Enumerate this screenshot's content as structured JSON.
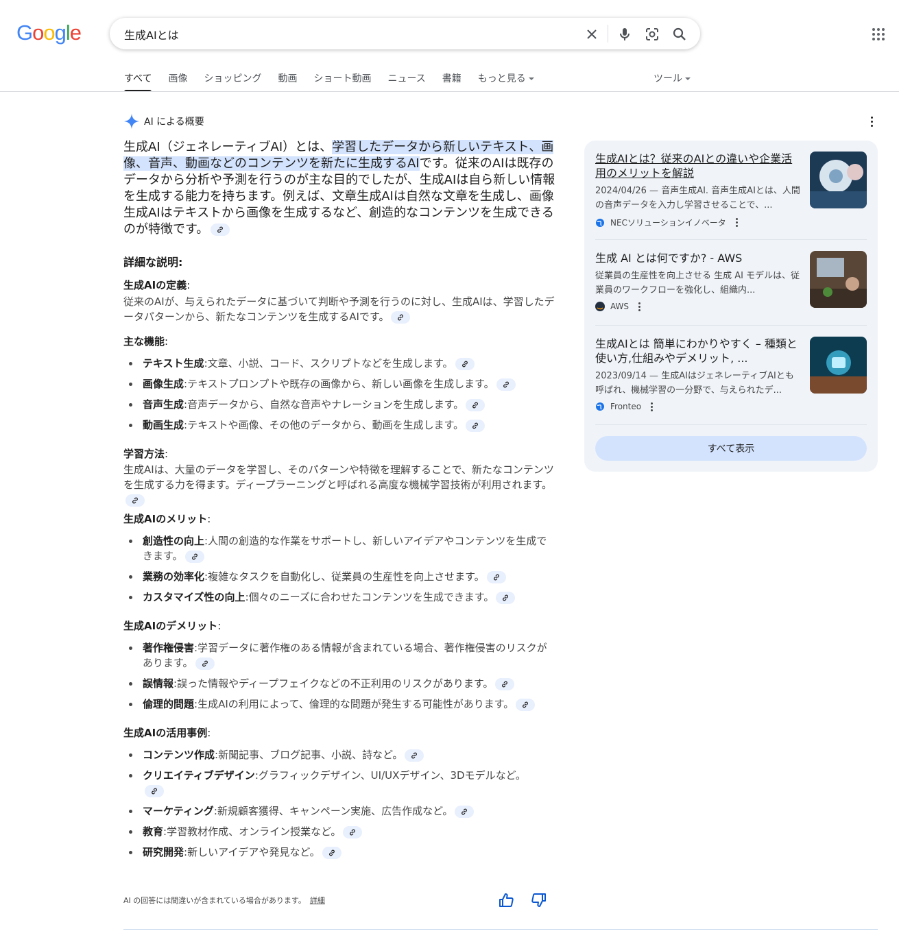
{
  "logo": {
    "letters": [
      "G",
      "o",
      "o",
      "g",
      "l",
      "e"
    ]
  },
  "search": {
    "query": "生成AIとは"
  },
  "tabs": [
    "すべて",
    "画像",
    "ショッピング",
    "動画",
    "ショート動画",
    "ニュース",
    "書籍",
    "もっと見る"
  ],
  "tools_label": "ツール",
  "ai": {
    "heading": "AI による概要",
    "intro_a": "生成AI（ジェネレーティブAI）とは、",
    "intro_highlight": "学習したデータから新しいテキスト、画像、音声、動画などのコンテンツを新たに生成するAI",
    "intro_b": "です。従来のAIは既存のデータから分析や予測を行うのが主な目的でしたが、生成AIは自ら新しい情報を生成する能力を持ちます。例えば、文章生成AIは自然な文章を生成し、画像生成AIはテキストから画像を生成するなど、創造的なコンテンツを生成できるのが特徴です。",
    "details_heading": "詳細な説明:",
    "def_title": "生成AIの定義",
    "def_text": "従来のAIが、与えられたデータに基づいて判断や予測を行うのに対し、生成AIは、学習したデータパターンから、新たなコンテンツを生成するAIです。",
    "features_title": "主な機能",
    "features": [
      {
        "term": "テキスト生成",
        "desc": ":文章、小説、コード、スクリプトなどを生成します。"
      },
      {
        "term": "画像生成",
        "desc": ":テキストプロンプトや既存の画像から、新しい画像を生成します。"
      },
      {
        "term": "音声生成",
        "desc": ":音声データから、自然な音声やナレーションを生成します。"
      },
      {
        "term": "動画生成",
        "desc": ":テキストや画像、その他のデータから、動画を生成します。"
      }
    ],
    "learning_title": "学習方法",
    "learning_text": "生成AIは、大量のデータを学習し、そのパターンや特徴を理解することで、新たなコンテンツを生成する力を得ます。ディープラーニングと呼ばれる高度な機械学習技術が利用されます。",
    "merits_title": "生成AIのメリット",
    "merits": [
      {
        "term": "創造性の向上",
        "desc": ":人間の創造的な作業をサポートし、新しいアイデアやコンテンツを生成できます。"
      },
      {
        "term": "業務の効率化",
        "desc": ":複雑なタスクを自動化し、従業員の生産性を向上させます。"
      },
      {
        "term": "カスタマイズ性の向上",
        "desc": ":個々のニーズに合わせたコンテンツを生成できます。"
      }
    ],
    "demerits_title": "生成AIのデメリット",
    "demerits": [
      {
        "term": "著作権侵害",
        "desc": ":学習データに著作権のある情報が含まれている場合、著作権侵害のリスクがあります。"
      },
      {
        "term": "誤情報",
        "desc": ":誤った情報やディープフェイクなどの不正利用のリスクがあります。"
      },
      {
        "term": "倫理的問題",
        "desc": ":生成AIの利用によって、倫理的な問題が発生する可能性があります。"
      }
    ],
    "cases_title": "生成AIの活用事例",
    "cases": [
      {
        "term": "コンテンツ作成",
        "desc": ":新聞記事、ブログ記事、小説、詩など。"
      },
      {
        "term": "クリエイティブデザイン",
        "desc": ":グラフィックデザイン、UI/UXデザイン、3Dモデルなど。"
      },
      {
        "term": "マーケティング",
        "desc": ":新規顧客獲得、キャンペーン実施、広告作成など。"
      },
      {
        "term": "教育",
        "desc": ":学習教材作成、オンライン授業など。"
      },
      {
        "term": "研究開発",
        "desc": ":新しいアイデアや発見など。"
      }
    ],
    "disclaimer": "AI の回答には間違いが含まれている場合があります。",
    "disclaimer_link": "詳細"
  },
  "sources": [
    {
      "title": "生成AIとは？従来のAIとの違いや企業活用のメリットを解説",
      "snippet": "2024/04/26 — 音声生成AI. 音声生成AIとは、人間の音声データを入力し学習させることで、...",
      "source": "NECソリューションイノベータ"
    },
    {
      "title": "生成 AI とは何ですか? - AWS",
      "snippet": "従業員の生産性を向上させる 生成 AI モデルは、従業員のワークフローを強化し、組織内...",
      "source": "AWS"
    },
    {
      "title": "生成AIとは 簡単にわかりやすく – 種類と使い方,仕組みやデメリット, ...",
      "snippet": "2023/09/14 — 生成AIはジェネレーティブAIとも呼ばれ、機械学習の一分野で、与えられたデ...",
      "source": "Fronteo"
    }
  ],
  "show_all": "すべて表示",
  "colors": {
    "blue": "#4285F4",
    "red": "#EA4335",
    "yellow": "#FBBC05",
    "green": "#34A853",
    "highlight": "#d3e3fd",
    "panel": "#f0f4f9"
  }
}
